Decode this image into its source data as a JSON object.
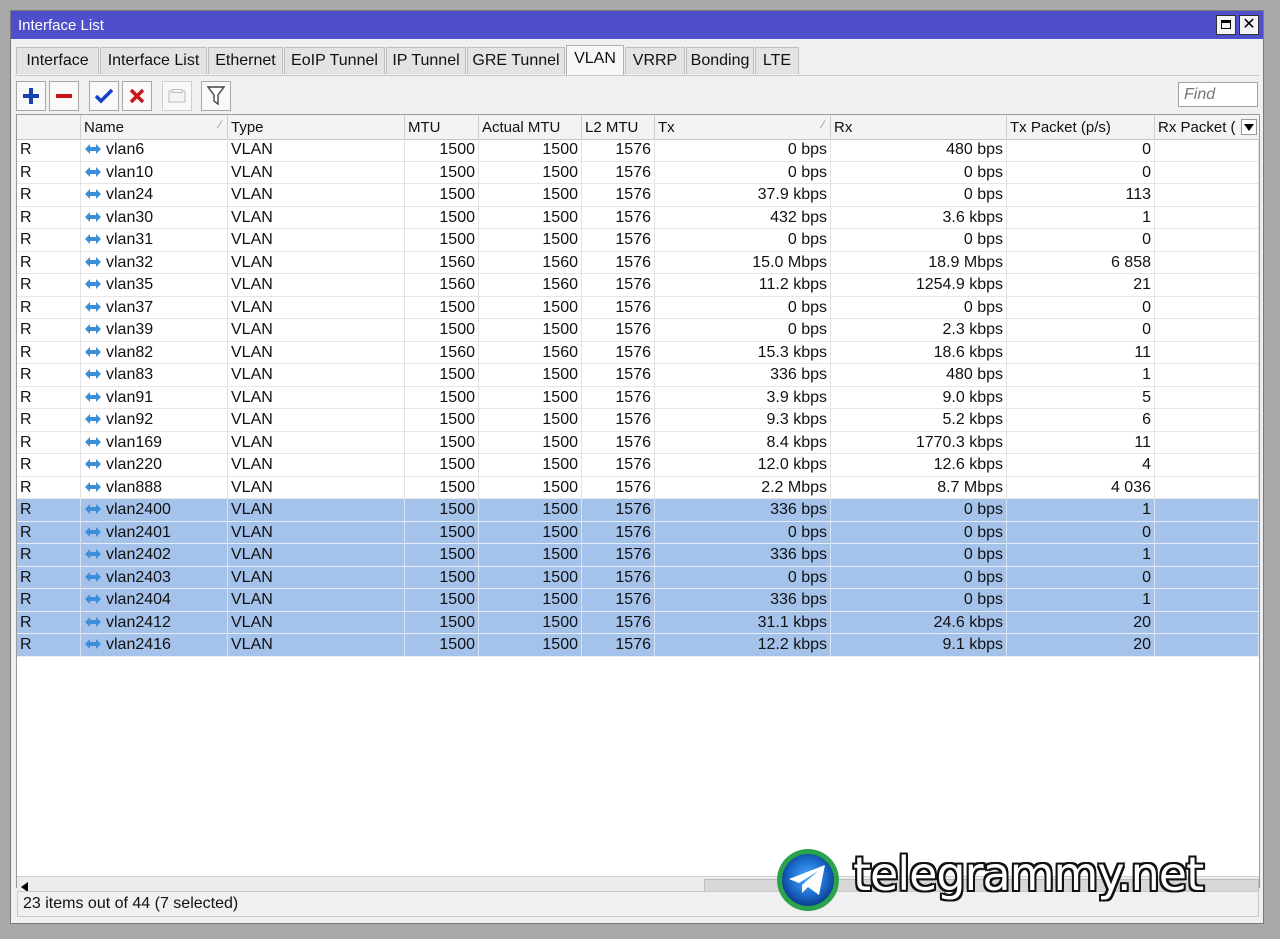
{
  "window": {
    "title": "Interface List"
  },
  "tabs": [
    {
      "label": "Interface"
    },
    {
      "label": "Interface List"
    },
    {
      "label": "Ethernet"
    },
    {
      "label": "EoIP Tunnel"
    },
    {
      "label": "IP Tunnel"
    },
    {
      "label": "GRE Tunnel"
    },
    {
      "label": "VLAN",
      "active": true
    },
    {
      "label": "VRRP"
    },
    {
      "label": "Bonding"
    },
    {
      "label": "LTE"
    }
  ],
  "toolbar": {
    "buttons": [
      {
        "icon": "plus-icon",
        "color": "#1540b0"
      },
      {
        "icon": "minus-icon",
        "color": "#c81414"
      },
      {
        "icon": "check-icon",
        "color": "#1440c8"
      },
      {
        "icon": "cross-icon",
        "color": "#c81414"
      },
      {
        "icon": "comment-icon",
        "disabled": true
      },
      {
        "icon": "filter-icon"
      }
    ],
    "find_placeholder": "Find"
  },
  "table": {
    "columns": [
      "",
      "Name",
      "Type",
      "MTU",
      "Actual MTU",
      "L2 MTU",
      "Tx",
      "Rx",
      "Tx Packet (p/s)",
      "Rx Packet ("
    ],
    "rows": [
      {
        "flag": "R",
        "name": "vlan6",
        "type": "VLAN",
        "mtu": "1500",
        "actual_mtu": "1500",
        "l2_mtu": "1576",
        "tx": "0 bps",
        "rx": "480 bps",
        "tx_packet": "0",
        "selected": false
      },
      {
        "flag": "R",
        "name": "vlan10",
        "type": "VLAN",
        "mtu": "1500",
        "actual_mtu": "1500",
        "l2_mtu": "1576",
        "tx": "0 bps",
        "rx": "0 bps",
        "tx_packet": "0",
        "selected": false
      },
      {
        "flag": "R",
        "name": "vlan24",
        "type": "VLAN",
        "mtu": "1500",
        "actual_mtu": "1500",
        "l2_mtu": "1576",
        "tx": "37.9 kbps",
        "rx": "0 bps",
        "tx_packet": "113",
        "selected": false
      },
      {
        "flag": "R",
        "name": "vlan30",
        "type": "VLAN",
        "mtu": "1500",
        "actual_mtu": "1500",
        "l2_mtu": "1576",
        "tx": "432 bps",
        "rx": "3.6 kbps",
        "tx_packet": "1",
        "selected": false
      },
      {
        "flag": "R",
        "name": "vlan31",
        "type": "VLAN",
        "mtu": "1500",
        "actual_mtu": "1500",
        "l2_mtu": "1576",
        "tx": "0 bps",
        "rx": "0 bps",
        "tx_packet": "0",
        "selected": false
      },
      {
        "flag": "R",
        "name": "vlan32",
        "type": "VLAN",
        "mtu": "1560",
        "actual_mtu": "1560",
        "l2_mtu": "1576",
        "tx": "15.0 Mbps",
        "rx": "18.9 Mbps",
        "tx_packet": "6 858",
        "selected": false
      },
      {
        "flag": "R",
        "name": "vlan35",
        "type": "VLAN",
        "mtu": "1560",
        "actual_mtu": "1560",
        "l2_mtu": "1576",
        "tx": "11.2 kbps",
        "rx": "1254.9 kbps",
        "tx_packet": "21",
        "selected": false
      },
      {
        "flag": "R",
        "name": "vlan37",
        "type": "VLAN",
        "mtu": "1500",
        "actual_mtu": "1500",
        "l2_mtu": "1576",
        "tx": "0 bps",
        "rx": "0 bps",
        "tx_packet": "0",
        "selected": false
      },
      {
        "flag": "R",
        "name": "vlan39",
        "type": "VLAN",
        "mtu": "1500",
        "actual_mtu": "1500",
        "l2_mtu": "1576",
        "tx": "0 bps",
        "rx": "2.3 kbps",
        "tx_packet": "0",
        "selected": false
      },
      {
        "flag": "R",
        "name": "vlan82",
        "type": "VLAN",
        "mtu": "1560",
        "actual_mtu": "1560",
        "l2_mtu": "1576",
        "tx": "15.3 kbps",
        "rx": "18.6 kbps",
        "tx_packet": "11",
        "selected": false
      },
      {
        "flag": "R",
        "name": "vlan83",
        "type": "VLAN",
        "mtu": "1500",
        "actual_mtu": "1500",
        "l2_mtu": "1576",
        "tx": "336 bps",
        "rx": "480 bps",
        "tx_packet": "1",
        "selected": false
      },
      {
        "flag": "R",
        "name": "vlan91",
        "type": "VLAN",
        "mtu": "1500",
        "actual_mtu": "1500",
        "l2_mtu": "1576",
        "tx": "3.9 kbps",
        "rx": "9.0 kbps",
        "tx_packet": "5",
        "selected": false
      },
      {
        "flag": "R",
        "name": "vlan92",
        "type": "VLAN",
        "mtu": "1500",
        "actual_mtu": "1500",
        "l2_mtu": "1576",
        "tx": "9.3 kbps",
        "rx": "5.2 kbps",
        "tx_packet": "6",
        "selected": false
      },
      {
        "flag": "R",
        "name": "vlan169",
        "type": "VLAN",
        "mtu": "1500",
        "actual_mtu": "1500",
        "l2_mtu": "1576",
        "tx": "8.4 kbps",
        "rx": "1770.3 kbps",
        "tx_packet": "11",
        "selected": false
      },
      {
        "flag": "R",
        "name": "vlan220",
        "type": "VLAN",
        "mtu": "1500",
        "actual_mtu": "1500",
        "l2_mtu": "1576",
        "tx": "12.0 kbps",
        "rx": "12.6 kbps",
        "tx_packet": "4",
        "selected": false
      },
      {
        "flag": "R",
        "name": "vlan888",
        "type": "VLAN",
        "mtu": "1500",
        "actual_mtu": "1500",
        "l2_mtu": "1576",
        "tx": "2.2 Mbps",
        "rx": "8.7 Mbps",
        "tx_packet": "4 036",
        "selected": false
      },
      {
        "flag": "R",
        "name": "vlan2400",
        "type": "VLAN",
        "mtu": "1500",
        "actual_mtu": "1500",
        "l2_mtu": "1576",
        "tx": "336 bps",
        "rx": "0 bps",
        "tx_packet": "1",
        "selected": true
      },
      {
        "flag": "R",
        "name": "vlan2401",
        "type": "VLAN",
        "mtu": "1500",
        "actual_mtu": "1500",
        "l2_mtu": "1576",
        "tx": "0 bps",
        "rx": "0 bps",
        "tx_packet": "0",
        "selected": true
      },
      {
        "flag": "R",
        "name": "vlan2402",
        "type": "VLAN",
        "mtu": "1500",
        "actual_mtu": "1500",
        "l2_mtu": "1576",
        "tx": "336 bps",
        "rx": "0 bps",
        "tx_packet": "1",
        "selected": true
      },
      {
        "flag": "R",
        "name": "vlan2403",
        "type": "VLAN",
        "mtu": "1500",
        "actual_mtu": "1500",
        "l2_mtu": "1576",
        "tx": "0 bps",
        "rx": "0 bps",
        "tx_packet": "0",
        "selected": true
      },
      {
        "flag": "R",
        "name": "vlan2404",
        "type": "VLAN",
        "mtu": "1500",
        "actual_mtu": "1500",
        "l2_mtu": "1576",
        "tx": "336 bps",
        "rx": "0 bps",
        "tx_packet": "1",
        "selected": true
      },
      {
        "flag": "R",
        "name": "vlan2412",
        "type": "VLAN",
        "mtu": "1500",
        "actual_mtu": "1500",
        "l2_mtu": "1576",
        "tx": "31.1 kbps",
        "rx": "24.6 kbps",
        "tx_packet": "20",
        "selected": true
      },
      {
        "flag": "R",
        "name": "vlan2416",
        "type": "VLAN",
        "mtu": "1500",
        "actual_mtu": "1500",
        "l2_mtu": "1576",
        "tx": "12.2 kbps",
        "rx": "9.1 kbps",
        "tx_packet": "20",
        "selected": true
      }
    ]
  },
  "status_text": "23 items out of 44 (7 selected)",
  "watermark": "telegrammy.net",
  "colors": {
    "titlebar": "#4f4fcb",
    "selection": "#a4c2ea"
  }
}
